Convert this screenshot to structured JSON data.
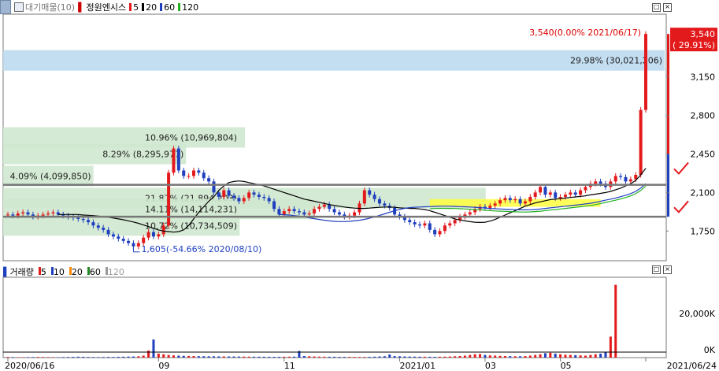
{
  "header": {
    "market_label": "대기매물(10)",
    "stock_name": "정원엔시스",
    "ma": [
      {
        "label": "5",
        "color": "#e31a1c"
      },
      {
        "label": "20",
        "color": "#000000"
      },
      {
        "label": "60",
        "color": "#1f3fbf"
      },
      {
        "label": "120",
        "color": "#22b022"
      }
    ]
  },
  "volume_header": {
    "title": "거래량",
    "ma": [
      {
        "label": "5",
        "color": "#e31a1c"
      },
      {
        "label": "10",
        "color": "#1f3fbf"
      },
      {
        "label": "20",
        "color": "#ff8c00"
      },
      {
        "label": "60",
        "color": "#228b22"
      },
      {
        "label": "120",
        "color": "#999999"
      }
    ]
  },
  "colors": {
    "up": "#e31a1c",
    "down": "#1f3fbf",
    "profile": "#cfe8cf",
    "profile_top": "#bcd9ef",
    "highlight": "#ffff33"
  },
  "chart_data": [
    {
      "type": "candlestick",
      "title": "정원엔시스",
      "y_ticks": [
        1750,
        2100,
        2450,
        2800,
        3150,
        3540
      ],
      "y_tick_labels": [
        "1,750",
        "2,100",
        "2,450",
        "2,800",
        "3,150"
      ],
      "ylim": [
        1480,
        3720
      ],
      "x_labels": [
        "2020/06/16",
        "09",
        "11",
        "2021/01",
        "03",
        "05",
        "2021/06/24"
      ],
      "last_price": {
        "value": 3540,
        "label": "3,540",
        "change": "( 29.91%)"
      },
      "annotations": {
        "high": "3,540(0.00% 2021/06/17)",
        "low": "1,605(-54.66% 2020/08/10)"
      },
      "volume_profile": [
        {
          "price": 3300,
          "pct": 29.98,
          "label": "29.98% (30,021,206)"
        },
        {
          "price": 2600,
          "pct": 10.96,
          "label": "10.96% (10,969,804)"
        },
        {
          "price": 2450,
          "pct": 8.29,
          "label": "8.29% (8,295,977)"
        },
        {
          "price": 2250,
          "pct": 4.09,
          "label": "4.09% (4,099,850)"
        },
        {
          "price": 2050,
          "pct": 21.87,
          "label": "21.87% (21,894,203)"
        },
        {
          "price": 1950,
          "pct": 14.11,
          "label": "14.11% (14,114,231)"
        },
        {
          "price": 1800,
          "pct": 10.72,
          "label": "10.72% (10,734,509)"
        }
      ],
      "support_lines": [
        2170,
        1880
      ],
      "series": {
        "close": [
          1900,
          1890,
          1910,
          1920,
          1900,
          1880,
          1890,
          1900,
          1910,
          1920,
          1900,
          1890,
          1880,
          1870,
          1860,
          1850,
          1830,
          1800,
          1780,
          1760,
          1720,
          1700,
          1680,
          1660,
          1640,
          1610,
          1640,
          1690,
          1740,
          1700,
          1720,
          1800,
          2280,
          2500,
          2300,
          2250,
          2250,
          2300,
          2280,
          2230,
          2200,
          2100,
          2060,
          2120,
          2070,
          2050,
          2020,
          2050,
          2100,
          2080,
          2060,
          2050,
          2020,
          1950,
          1900,
          1930,
          1950,
          1930,
          1920,
          1900,
          1910,
          1950,
          1970,
          1990,
          1950,
          1920,
          1900,
          1880,
          1890,
          1920,
          2000,
          2120,
          2080,
          2040,
          2000,
          1980,
          1960,
          1900,
          1880,
          1850,
          1830,
          1810,
          1800,
          1820,
          1760,
          1720,
          1750,
          1800,
          1820,
          1850,
          1880,
          1900,
          1920,
          1950,
          1970,
          1960,
          1980,
          2000,
          2030,
          2050,
          2030,
          2040,
          2000,
          2020,
          2060,
          2100,
          2150,
          2080,
          2100,
          2050,
          2060,
          2080,
          2100,
          2080,
          2120,
          2150,
          2180,
          2200,
          2180,
          2150,
          2200,
          2250,
          2240,
          2200,
          2220,
          2260,
          2850,
          3540
        ],
        "ma20": [
          1900,
          1900,
          1900,
          1900,
          1900,
          1895,
          1893,
          1890,
          1885,
          1880,
          1875,
          1868,
          1860,
          1852,
          1842,
          1832,
          1820,
          1805,
          1790,
          1775,
          1760,
          1750,
          1745,
          1740,
          1745,
          1760,
          1800,
          1860,
          1920,
          1970,
          2020,
          2060,
          2120,
          2160,
          2190,
          2200,
          2205,
          2200,
          2190,
          2180,
          2170,
          2160,
          2145,
          2130,
          2115,
          2100,
          2085,
          2070,
          2055,
          2040,
          2030,
          2020,
          2010,
          2000,
          1990,
          1982,
          1975,
          1968,
          1962,
          1958,
          1955,
          1955,
          1958,
          1962,
          1965,
          1968,
          1968,
          1965,
          1960,
          1958,
          1955,
          1955,
          1950,
          1945,
          1935,
          1920,
          1905,
          1890,
          1875,
          1860,
          1850,
          1842,
          1835,
          1830,
          1828,
          1830,
          1840,
          1855,
          1875,
          1895,
          1915,
          1935,
          1955,
          1975,
          1990,
          2005,
          2015,
          2025,
          2035,
          2040,
          2045,
          2050,
          2055,
          2060,
          2065,
          2070,
          2078,
          2085,
          2092,
          2100,
          2110,
          2125,
          2140,
          2160,
          2180,
          2210,
          2260,
          2320
        ],
        "ma60": [
          1900,
          1898,
          1895,
          1890,
          1885,
          1878,
          1870,
          1862,
          1855,
          1848,
          1842,
          1838,
          1836,
          1836,
          1838,
          1842,
          1848,
          1856,
          1866,
          1878,
          1892,
          1906,
          1920,
          1934,
          1946,
          1956,
          1962,
          1966,
          1968,
          1970,
          1972,
          1974,
          1976,
          1976,
          1975,
          1974,
          1972,
          1970,
          1968,
          1965,
          1962,
          1958,
          1955,
          1952,
          1950,
          1948,
          1946,
          1944,
          1942,
          1942,
          1943,
          1946,
          1950,
          1955,
          1960,
          1965,
          1970,
          1975,
          1980,
          1985,
          1990,
          1996,
          2002,
          2010,
          2020,
          2030,
          2040,
          2050,
          2062,
          2075,
          2090,
          2110,
          2140,
          2180
        ]
      }
    },
    {
      "type": "bar",
      "title": "거래량",
      "y_tick_labels": [
        "20,000K",
        "0K"
      ],
      "ylim": [
        0,
        35000
      ],
      "values": [
        300,
        250,
        200,
        180,
        220,
        260,
        300,
        280,
        240,
        200,
        180,
        260,
        300,
        350,
        420,
        380,
        300,
        260,
        240,
        280,
        320,
        300,
        380,
        420,
        460,
        500,
        600,
        900,
        3200,
        8200,
        1800,
        1500,
        1200,
        1000,
        900,
        800,
        750,
        700,
        650,
        620,
        600,
        580,
        560,
        540,
        520,
        500,
        480,
        460,
        440,
        420,
        420,
        400,
        380,
        360,
        380,
        400,
        420,
        440,
        3000,
        700,
        600,
        500,
        450,
        420,
        400,
        380,
        360,
        340,
        320,
        300,
        300,
        320,
        360,
        420,
        520,
        620,
        1400,
        700,
        600,
        520,
        480,
        440,
        420,
        400,
        380,
        360,
        400,
        440,
        500,
        600,
        700,
        900,
        1200,
        1500,
        1600,
        1200,
        1000,
        900,
        800,
        700,
        650,
        600,
        620,
        700,
        900,
        1200,
        1500,
        2000,
        2200,
        1800,
        1500,
        1300,
        1200,
        1100,
        1000,
        900,
        1200,
        1500,
        1800,
        2500,
        9500,
        33000
      ]
    }
  ]
}
